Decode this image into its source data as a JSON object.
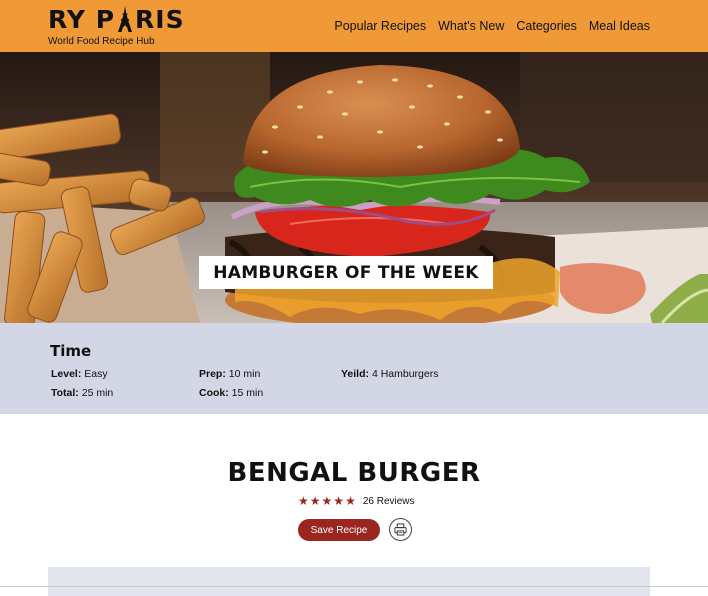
{
  "header": {
    "logo_left": "RY P",
    "logo_right": "RIS",
    "tagline": "World Food Recipe Hub",
    "nav": [
      {
        "label": "Popular Recipes"
      },
      {
        "label": "What's New"
      },
      {
        "label": "Categories"
      },
      {
        "label": "Meal Ideas"
      }
    ]
  },
  "hero": {
    "badge": "HAMBURGER OF THE WEEK",
    "image": "hamburger-with-fries-photo"
  },
  "time": {
    "title": "Time",
    "level": {
      "label": "Level:",
      "value": "Easy"
    },
    "total": {
      "label": "Total:",
      "value": "25 min"
    },
    "prep": {
      "label": "Prep:",
      "value": "10 min"
    },
    "cook": {
      "label": "Cook:",
      "value": "15 min"
    },
    "yield": {
      "label": "Yeild:",
      "value": "4 Hamburgers"
    }
  },
  "recipe": {
    "title": "BENGAL BURGER",
    "rating": 5,
    "reviews": "26 Reviews",
    "save_label": "Save Recipe",
    "print_icon": "printer-icon"
  },
  "colors": {
    "header_bg": "#ef9a36",
    "time_band_bg": "#d2d6e5",
    "accent": "#9b2620"
  }
}
